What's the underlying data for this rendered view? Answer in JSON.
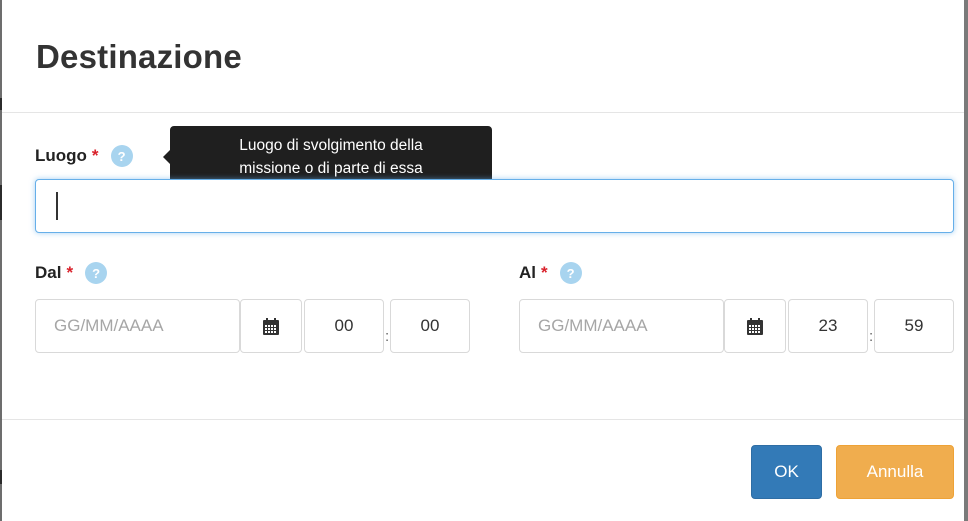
{
  "dialog": {
    "title": "Destinazione"
  },
  "luogo": {
    "label": "Luogo",
    "required_mark": "*",
    "help_glyph": "?",
    "value": "",
    "tooltip_line1": "Luogo di svolgimento della",
    "tooltip_line2": "missione o di parte di essa"
  },
  "dal": {
    "label": "Dal",
    "required_mark": "*",
    "help_glyph": "?",
    "date_placeholder": "GG/MM/AAAA",
    "hour": "00",
    "minute": "00",
    "separator": ":"
  },
  "al": {
    "label": "Al",
    "required_mark": "*",
    "help_glyph": "?",
    "date_placeholder": "GG/MM/AAAA",
    "hour": "23",
    "minute": "59",
    "separator": ":"
  },
  "footer": {
    "ok_label": "OK",
    "cancel_label": "Annulla"
  },
  "colors": {
    "primary": "#337ab7",
    "warning": "#f0ad4e",
    "required": "#d9202a",
    "help": "#a8d4ef",
    "focus": "#66afe9"
  },
  "icons": {
    "calendar": "calendar-icon",
    "help": "question-icon"
  }
}
